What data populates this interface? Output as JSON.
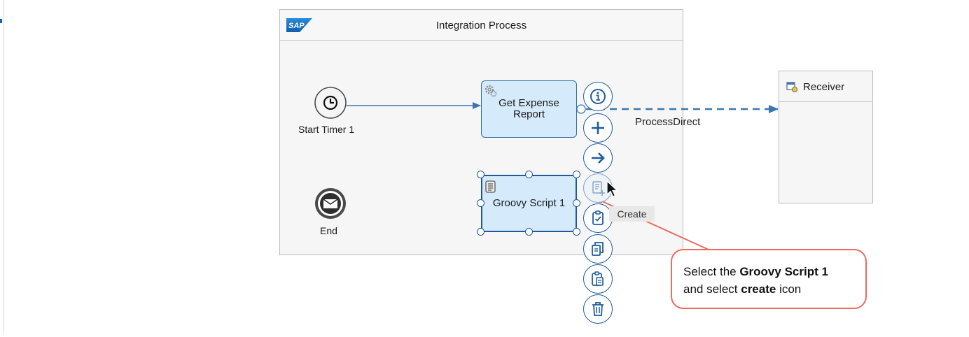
{
  "pool": {
    "title": "Integration Process",
    "logo_text": "SAP"
  },
  "participant": {
    "title": "Receiver",
    "icon": "receiver-icon"
  },
  "events": {
    "start": {
      "label": "Start Timer 1",
      "icon": "clock-icon"
    },
    "end": {
      "label": "End",
      "icon": "envelope-icon"
    }
  },
  "tasks": {
    "expense": {
      "line1": "Get Expense",
      "line2": "Report",
      "icon": "gear-icon"
    },
    "groovy": {
      "label": "Groovy Script 1",
      "icon": "script-icon"
    }
  },
  "connection": {
    "label": "ProcessDirect"
  },
  "toolbar": {
    "buttons": [
      {
        "name": "info-button",
        "icon": "info-icon"
      },
      {
        "name": "add-button",
        "icon": "plus-icon"
      },
      {
        "name": "connect-button",
        "icon": "arrow-right-icon"
      },
      {
        "name": "create-button",
        "icon": "create-script-icon"
      },
      {
        "name": "validate-button",
        "icon": "clipboard-check-icon"
      },
      {
        "name": "copy-button",
        "icon": "copy-icon"
      },
      {
        "name": "paste-button",
        "icon": "paste-icon"
      },
      {
        "name": "delete-button",
        "icon": "trash-icon"
      }
    ],
    "tooltip": "Create"
  },
  "callout": {
    "prefix": "Select the ",
    "bold1": "Groovy Script 1",
    "middle": "and select ",
    "bold2": "create",
    "suffix": " icon"
  },
  "colors": {
    "accent": "#1f5c9e",
    "task_fill": "#d5eafb",
    "callout_border": "#ec6a5e",
    "sap_blue": "#1a73c7"
  }
}
